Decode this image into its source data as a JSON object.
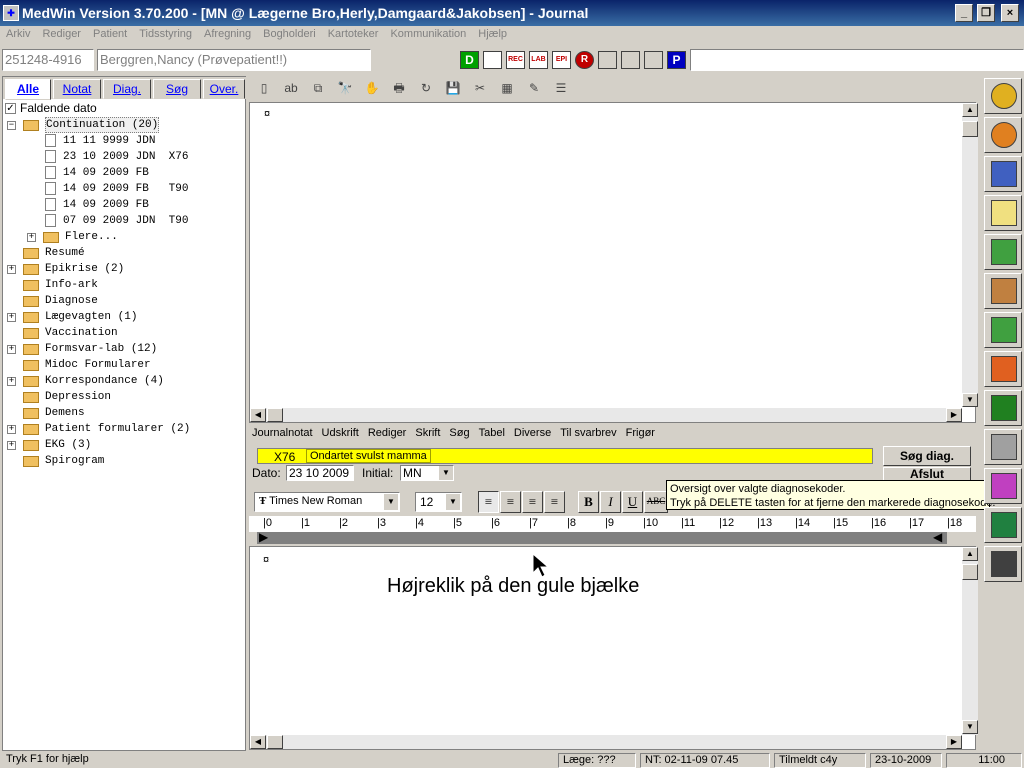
{
  "window": {
    "title": "MedWin Version 3.70.200 - [MN @ Lægerne Bro,Herly,Damgaard&Jakobsen] - Journal"
  },
  "menu": [
    "Arkiv",
    "Rediger",
    "Patient",
    "Tidsstyring",
    "Afregning",
    "Bogholderi",
    "Kartoteker",
    "Kommunikation",
    "Hjælp"
  ],
  "patient": {
    "cpr": "251248-4916",
    "name": "Berggren,Nancy (Prøvepatient!!)"
  },
  "toolbar_icons": [
    {
      "label": "D",
      "color": "#00a000"
    },
    {
      "label": "",
      "color": "#c00000"
    },
    {
      "label": "REC",
      "color": "#c00000"
    },
    {
      "label": "LAB",
      "color": "#c00000"
    },
    {
      "label": "EPI",
      "color": "#c00000"
    },
    {
      "label": "R",
      "color": "#c00000"
    },
    {
      "label": "",
      "color": "#808080"
    },
    {
      "label": "",
      "color": "#808080"
    },
    {
      "label": "",
      "color": "#808080"
    },
    {
      "label": "P",
      "color": "#0000c0"
    }
  ],
  "left_tabs": [
    "Alle",
    "Notat",
    "Diag.",
    "Søg",
    "Over."
  ],
  "sort_label": "Faldende dato",
  "tree": [
    {
      "level": 0,
      "expander": "−",
      "icon": "folder",
      "label": "Continuation (20)",
      "selected": true
    },
    {
      "level": 1,
      "expander": "",
      "icon": "doc",
      "label": "11 11 9999 JDN"
    },
    {
      "level": 1,
      "expander": "",
      "icon": "doc",
      "label": "23 10 2009 JDN  X76"
    },
    {
      "level": 1,
      "expander": "",
      "icon": "doc",
      "label": "14 09 2009 FB"
    },
    {
      "level": 1,
      "expander": "",
      "icon": "doc",
      "label": "14 09 2009 FB   T90"
    },
    {
      "level": 1,
      "expander": "",
      "icon": "doc",
      "label": "14 09 2009 FB"
    },
    {
      "level": 1,
      "expander": "",
      "icon": "doc",
      "label": "07 09 2009 JDN  T90"
    },
    {
      "level": 1,
      "expander": "+",
      "icon": "folder",
      "label": "Flere..."
    },
    {
      "level": 0,
      "expander": "",
      "icon": "folder",
      "label": "Resumé"
    },
    {
      "level": 0,
      "expander": "+",
      "icon": "folder",
      "label": "Epikrise (2)"
    },
    {
      "level": 0,
      "expander": "",
      "icon": "folder",
      "label": "Info-ark"
    },
    {
      "level": 0,
      "expander": "",
      "icon": "folder",
      "label": "Diagnose"
    },
    {
      "level": 0,
      "expander": "+",
      "icon": "folder",
      "label": "Lægevagten (1)"
    },
    {
      "level": 0,
      "expander": "",
      "icon": "folder",
      "label": "Vaccination"
    },
    {
      "level": 0,
      "expander": "+",
      "icon": "folder",
      "label": "Formsvar-lab (12)"
    },
    {
      "level": 0,
      "expander": "",
      "icon": "folder",
      "label": "Midoc Formularer"
    },
    {
      "level": 0,
      "expander": "+",
      "icon": "folder",
      "label": "Korrespondance (4)"
    },
    {
      "level": 0,
      "expander": "",
      "icon": "folder",
      "label": "Depression"
    },
    {
      "level": 0,
      "expander": "",
      "icon": "folder",
      "label": "Demens"
    },
    {
      "level": 0,
      "expander": "+",
      "icon": "folder",
      "label": "Patient formularer (2)"
    },
    {
      "level": 0,
      "expander": "+",
      "icon": "folder",
      "label": "EKG (3)"
    },
    {
      "level": 0,
      "expander": "",
      "icon": "folder",
      "label": "Spirogram"
    }
  ],
  "editor_toolbar": [
    "▯",
    "ab",
    "⧉",
    "🔭",
    "✋",
    "🖶",
    "↻",
    "💾",
    "✂",
    "▦",
    "✎",
    "☰"
  ],
  "top_doc": {
    "marker": "¤"
  },
  "note_menu": [
    "Journalnotat",
    "Udskrift",
    "Rediger",
    "Skrift",
    "Søg",
    "Tabel",
    "Diverse",
    "Til svarbrev",
    "Frigør"
  ],
  "diagnosis": {
    "code": "X76",
    "text": "Ondartet svulst mamma"
  },
  "search_diag_button": "Søg diag.",
  "close_button": "Afslut",
  "dato": {
    "label": "Dato:",
    "value": "23 10 2009",
    "initial_label": "Initial:",
    "initial_value": "MN"
  },
  "format": {
    "font": "Times New Roman",
    "size": "12",
    "bold": "B",
    "italic": "I",
    "underline": "U",
    "strike": "ABC"
  },
  "ruler_numbers": [
    "0",
    "1",
    "2",
    "3",
    "4",
    "5",
    "6",
    "7",
    "8",
    "9",
    "10",
    "11",
    "12",
    "13",
    "14",
    "15",
    "16",
    "17",
    "18"
  ],
  "tooltip": {
    "line1": "Oversigt over valgte diagnosekoder.",
    "line2": "Tryk på DELETE tasten for at fjerne den markerede diagnosekode."
  },
  "bottom_doc": {
    "marker": "¤",
    "instruction": "Højreklik på den gule bjælke"
  },
  "right_buttons": [
    {
      "name": "stopwatch-icon",
      "color": "#e0b020"
    },
    {
      "name": "stopwatch-red-icon",
      "color": "#e08020"
    },
    {
      "name": "clock-calendar-icon",
      "color": "#4060c0"
    },
    {
      "name": "calendar-icon",
      "color": "#f0e080"
    },
    {
      "name": "calendar-half-icon",
      "color": "#40a040"
    },
    {
      "name": "doctor-icon",
      "color": "#c08040"
    },
    {
      "name": "records-icon",
      "color": "#40a040"
    },
    {
      "name": "syringe-icon",
      "color": "#e06020"
    },
    {
      "name": "chart-icon",
      "color": "#208020"
    },
    {
      "name": "hand-icon",
      "color": "#a0a0a0"
    },
    {
      "name": "map-icon",
      "color": "#c040c0"
    },
    {
      "name": "excel-icon",
      "color": "#208040"
    },
    {
      "name": "exit-icon",
      "color": "#404040"
    }
  ],
  "status": {
    "help": "Tryk F1 for hjælp",
    "doctor": "Læge: ???",
    "nt": "NT: 02-11-09 07.45",
    "registered": "Tilmeldt c4y",
    "date": "23-10-2009",
    "time": "11:00"
  }
}
